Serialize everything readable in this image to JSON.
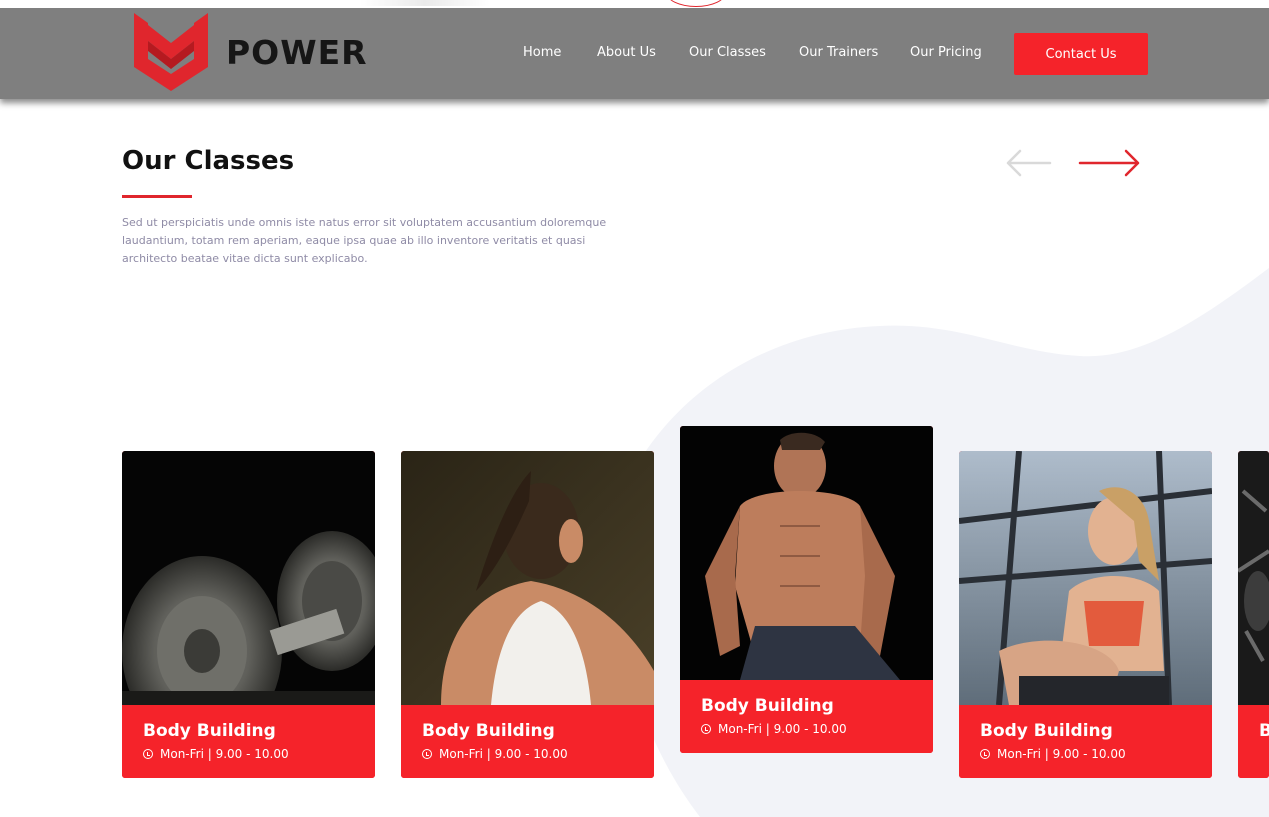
{
  "brand": {
    "name": "POWER",
    "accent_color": "#f5232a",
    "logo_icon": "shield-logo-icon"
  },
  "nav": {
    "items": [
      {
        "label": "Home"
      },
      {
        "label": "About Us"
      },
      {
        "label": "Our Classes"
      },
      {
        "label": "Our Trainers"
      },
      {
        "label": "Our Pricing"
      }
    ],
    "cta_label": "Contact Us"
  },
  "section": {
    "title": "Our Classes",
    "description": "Sed ut perspiciatis unde omnis iste natus error sit voluptatem accusantium doloremque laudantium, totam rem aperiam, eaque ipsa quae ab illo inventore veritatis et quasi architecto beatae vitae dicta sunt explicabo.",
    "prev_icon": "arrow-left-icon",
    "next_icon": "arrow-right-icon"
  },
  "classes": [
    {
      "title": "Body Building",
      "schedule": "Mon-Fri | 9.00 - 10.00",
      "photo": "dumbbell-photo"
    },
    {
      "title": "Body Building",
      "schedule": "Mon-Fri | 9.00 - 10.00",
      "photo": "woman-back-photo"
    },
    {
      "title": "Body Building",
      "schedule": "Mon-Fri | 9.00 - 10.00",
      "photo": "muscular-man-photo"
    },
    {
      "title": "Body Building",
      "schedule": "Mon-Fri | 9.00 - 10.00",
      "photo": "woman-gym-photo"
    },
    {
      "title": "B",
      "schedule": "",
      "photo": "gym-equipment-photo"
    }
  ]
}
